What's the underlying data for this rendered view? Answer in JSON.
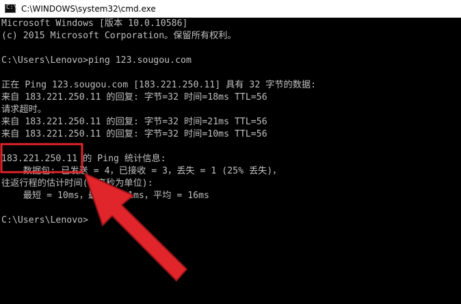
{
  "window": {
    "title": "C:\\WINDOWS\\system32\\cmd.exe"
  },
  "console": {
    "lines": [
      "Microsoft Windows [版本 10.0.10586]",
      "(c) 2015 Microsoft Corporation。保留所有权利。",
      "",
      "C:\\Users\\Lenovo>ping 123.sougou.com",
      "",
      "正在 Ping 123.sougou.com [183.221.250.11] 具有 32 字节的数据:",
      "来自 183.221.250.11 的回复: 字节=32 时间=18ms TTL=56",
      "请求超时。",
      "来自 183.221.250.11 的回复: 字节=32 时间=21ms TTL=56",
      "来自 183.221.250.11 的回复: 字节=32 时间=10ms TTL=56",
      "",
      "183.221.250.11 的 Ping 统计信息:",
      "    数据包: 已发送 = 4，已接收 = 3，丢失 = 1 (25% 丢失)，",
      "往返行程的估计时间(以毫秒为单位):",
      "    最短 = 10ms，最长 = 21ms，平均 = 16ms",
      "",
      "C:\\Users\\Lenovo>"
    ]
  },
  "annotation_color": "#e0252b"
}
